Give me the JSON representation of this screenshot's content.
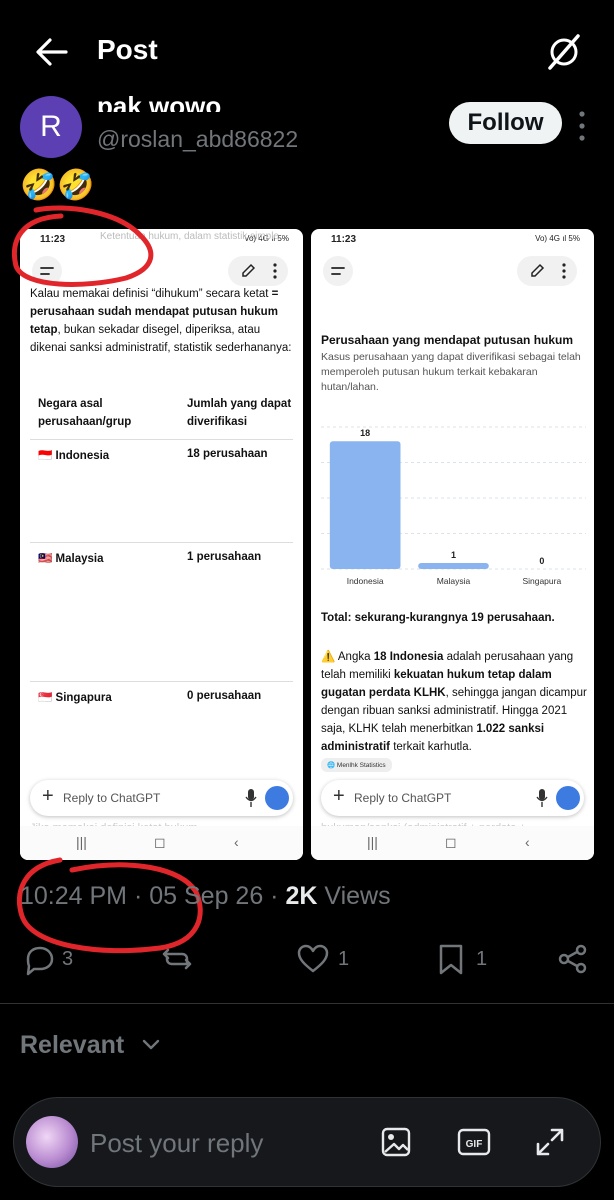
{
  "header": {
    "title": "Post"
  },
  "author": {
    "avatar_letter": "R",
    "name": "pak wowo",
    "handle": "@roslan_abd86822",
    "follow_label": "Follow"
  },
  "post": {
    "text": "🤣🤣"
  },
  "screenshot1": {
    "status_time": "11:23",
    "status_right": "Vo) 4G ıl 5%",
    "faded_top": "Ketentuan hukum, dalam statistik simple",
    "intro_line1": "Kalau memakai definisi “dihukum” secara ketat",
    "intro_line2_bold": "= perusahaan sudah mendapat putusan hukum tetap",
    "intro_line2_rest": ", bukan sekadar disegel, diperiksa, atau dikenai sanksi administratif, statistik sederhananya:",
    "table": {
      "headers": [
        "Negara asal perusahaan/grup",
        "Jumlah yang dapat diverifikasi"
      ],
      "rows": [
        {
          "flag": "🇮🇩",
          "country": "Indonesia",
          "count": "18 perusahaan"
        },
        {
          "flag": "🇲🇾",
          "country": "Malaysia",
          "count": "1 perusahaan"
        },
        {
          "flag": "🇸🇬",
          "country": "Singapura",
          "count": "0 perusahaan"
        }
      ]
    },
    "reply_placeholder": "Reply to ChatGPT",
    "faded_bottom": "Jika memakai definisi ketat hukum"
  },
  "screenshot2": {
    "status_time": "11:23",
    "status_right": "Vo) 4G ıl 5%",
    "chart_title": "Perusahaan yang mendapat putusan hukum",
    "chart_subtitle": "Kasus perusahaan yang dapat diverifikasi sebagai telah memperoleh putusan hukum terkait kebakaran hutan/lahan.",
    "chart_data": {
      "type": "bar",
      "categories": [
        "Indonesia",
        "Malaysia",
        "Singapura"
      ],
      "values": [
        18,
        1,
        0
      ],
      "bar_color": "#8ab4f0",
      "ylim": [
        0,
        20
      ]
    },
    "total": "Total: sekurang-kurangnya 19 perusahaan.",
    "para": {
      "warn": "⚠️",
      "p1": " Angka ",
      "b1": "18 Indonesia",
      "p2": " adalah perusahaan yang telah memiliki ",
      "b2": "kekuatan hukum tetap dalam gugatan perdata KLHK",
      "p3": ", sehingga jangan dicampur dengan ribuan sanksi administratif. Hingga 2021 saja, KLHK telah menerbitkan ",
      "b3": "1.022 sanksi administratif",
      "p4": " terkait karhutla."
    },
    "chip": "Menlhk Statistics",
    "reply_placeholder": "Reply to ChatGPT",
    "faded_bottom": "hukuman/sanksi (administratif + perdata +"
  },
  "meta": {
    "time": "10:24 PM",
    "sep1": " · ",
    "date": "05 Sep 26",
    "sep2": " · ",
    "views_count": "2K",
    "views_label": " Views"
  },
  "actions": {
    "replies": "3",
    "likes": "1",
    "bookmarks": "1"
  },
  "sort": {
    "label": "Relevant"
  },
  "reply": {
    "placeholder": "Post your reply"
  },
  "colors": {
    "accent_red": "#e0262b",
    "chatgpt_blue": "#3d7be0"
  }
}
